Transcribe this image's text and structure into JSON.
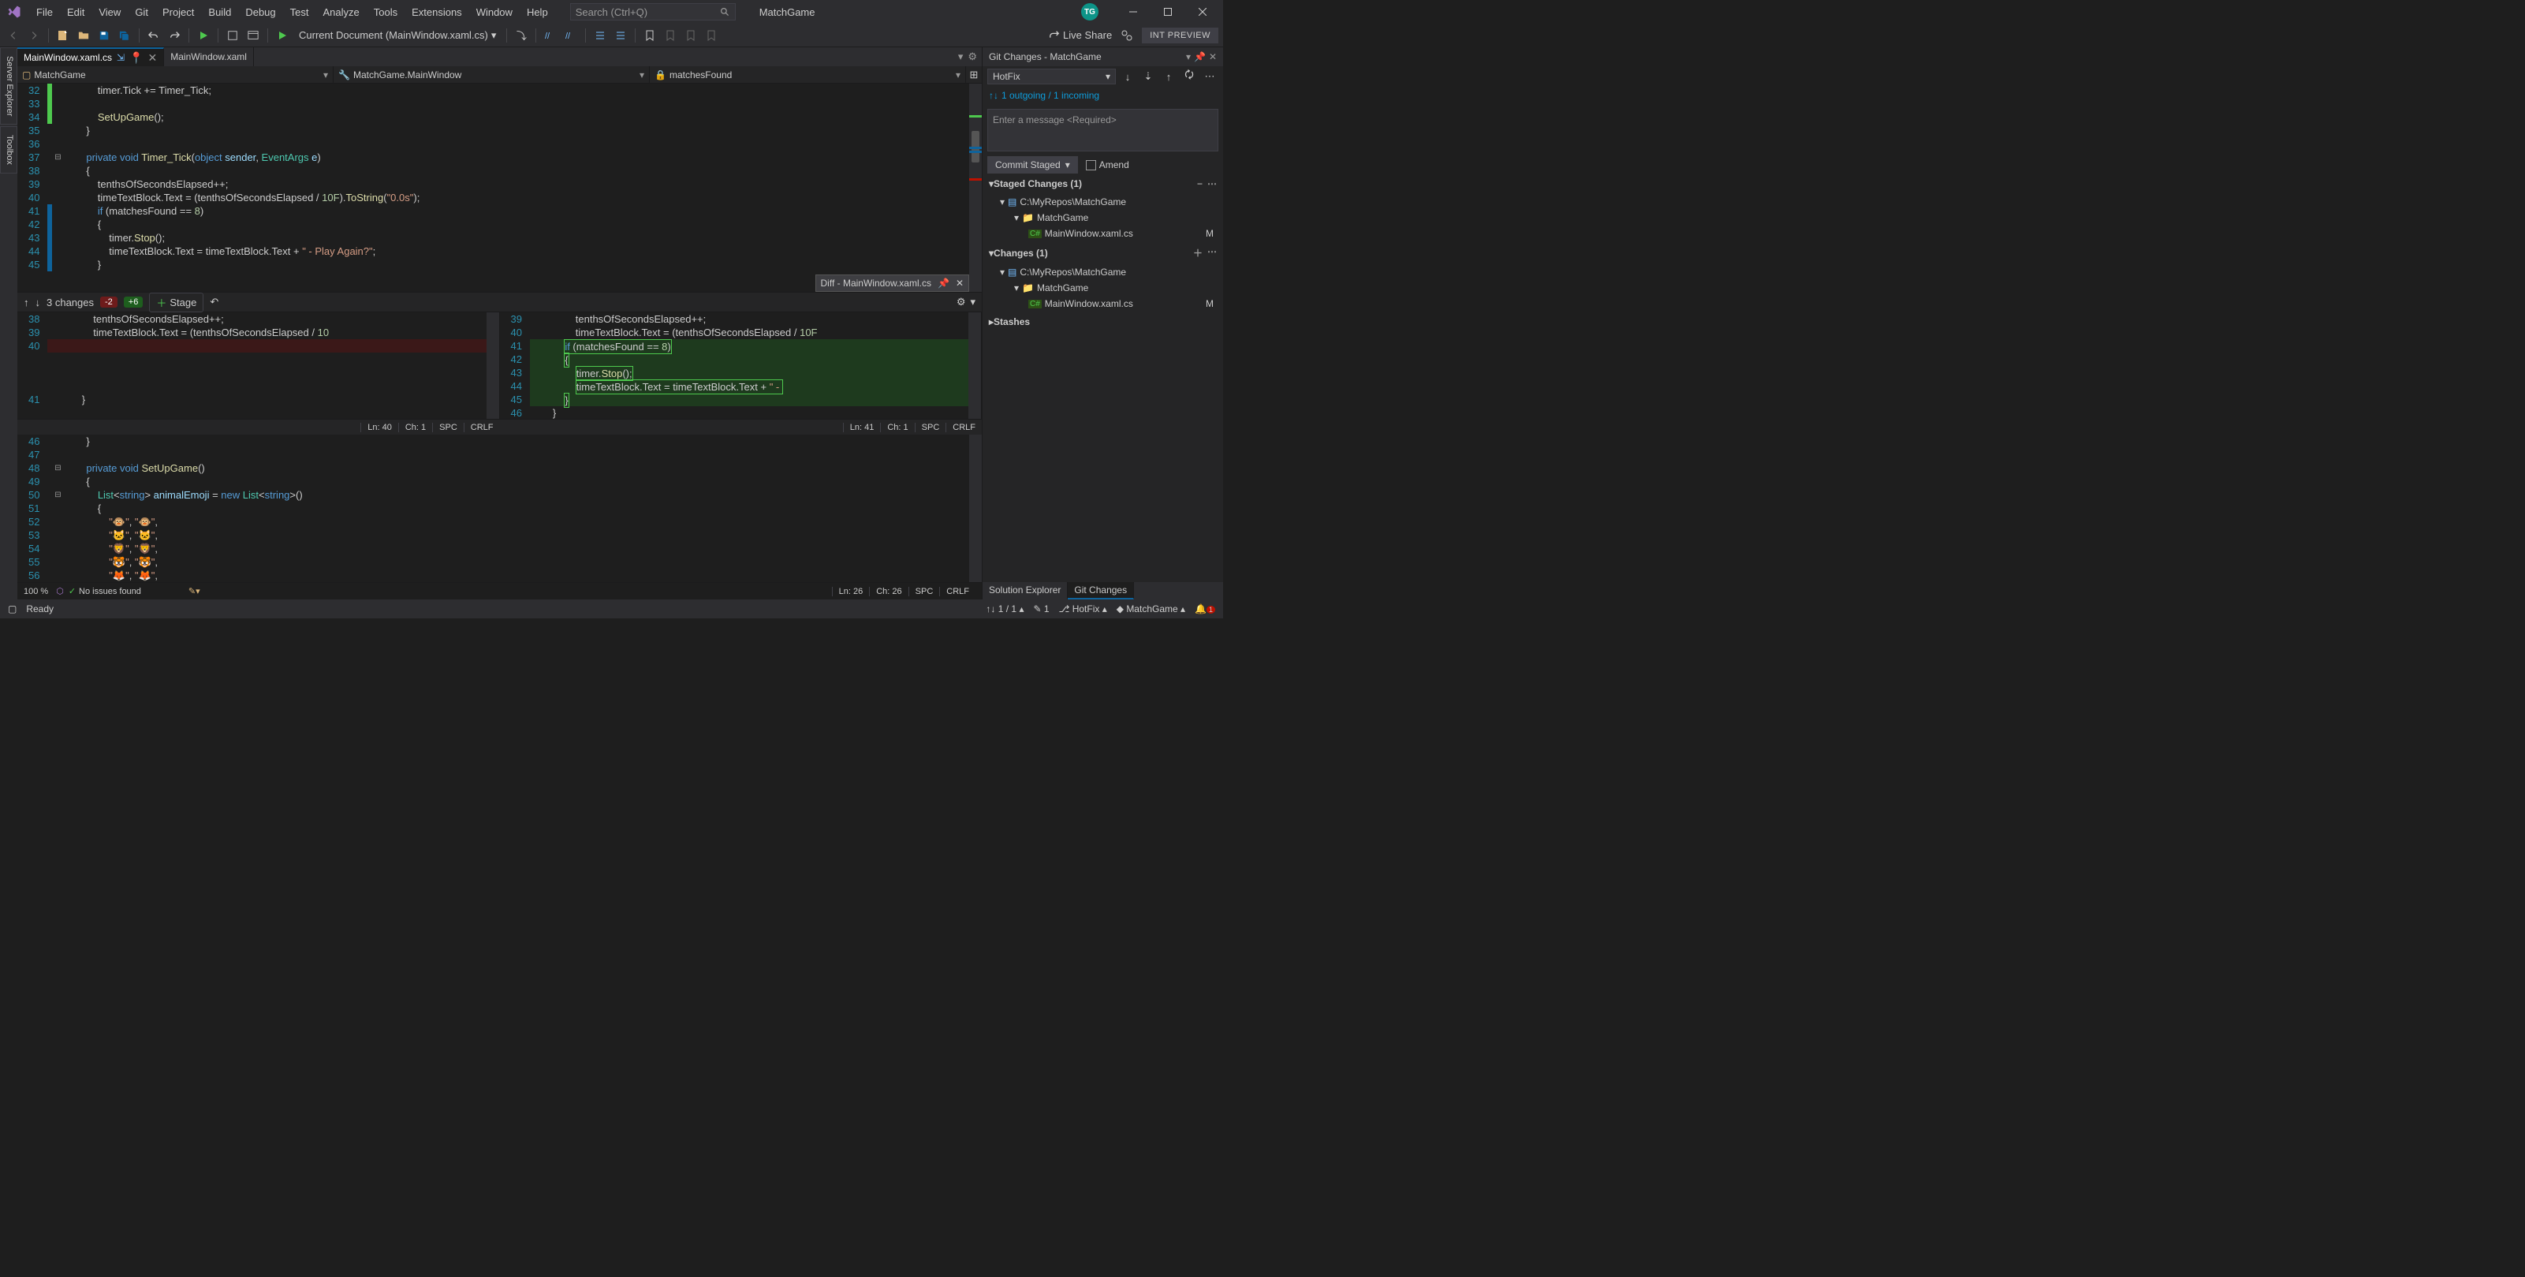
{
  "titlebar": {
    "menus": [
      "File",
      "Edit",
      "View",
      "Git",
      "Project",
      "Build",
      "Debug",
      "Test",
      "Analyze",
      "Tools",
      "Extensions",
      "Window",
      "Help"
    ],
    "search_placeholder": "Search (Ctrl+Q)",
    "solution": "MatchGame",
    "avatar": "TG"
  },
  "toolbar": {
    "current_doc": "Current Document (MainWindow.xaml.cs)",
    "live_share": "Live Share",
    "int_preview": "INT PREVIEW"
  },
  "side_tabs": [
    "Server Explorer",
    "Toolbox"
  ],
  "doc_tabs": [
    {
      "label": "MainWindow.xaml.cs",
      "active": true
    },
    {
      "label": "MainWindow.xaml",
      "active": false
    }
  ],
  "nav": {
    "ns": "MatchGame",
    "cls": "MatchGame.MainWindow",
    "mem": "matchesFound"
  },
  "code_top": [
    {
      "n": 32,
      "html": "            timer.Tick += Timer_Tick;"
    },
    {
      "n": 33,
      "html": ""
    },
    {
      "n": 34,
      "html": "            <span class='fn'>SetUpGame</span>();"
    },
    {
      "n": 35,
      "html": "        }"
    },
    {
      "n": 36,
      "html": ""
    },
    {
      "n": 37,
      "html": "        <span class='kw'>private</span> <span class='kw'>void</span> <span class='fn'>Timer_Tick</span>(<span class='kw'>object</span> <span class='param'>sender</span>, <span class='type'>EventArgs</span> <span class='param'>e</span>)"
    },
    {
      "n": 38,
      "html": "        {"
    },
    {
      "n": 39,
      "html": "            tenthsOfSecondsElapsed++;"
    },
    {
      "n": 40,
      "html": "            timeTextBlock.Text = (tenthsOfSecondsElapsed / <span class='num'>10F</span>).<span class='fn'>ToString</span>(<span class='str'>\"0.0s\"</span>);"
    },
    {
      "n": 41,
      "html": "            <span class='kw'>if</span> (matchesFound == <span class='num'>8</span>)"
    },
    {
      "n": 42,
      "html": "            {"
    },
    {
      "n": 43,
      "html": "                timer.<span class='fn'>Stop</span>();"
    },
    {
      "n": 44,
      "html": "                timeTextBlock.Text = timeTextBlock.Text + <span class='str'>\" - Play Again?\"</span>;"
    },
    {
      "n": 45,
      "html": "            }"
    }
  ],
  "diff": {
    "tab_label": "Diff - MainWindow.xaml.cs",
    "changes": "3 changes",
    "removed": "-2",
    "added": "+6",
    "stage": "Stage",
    "left": [
      {
        "n": 38,
        "html": "                tenthsOfSecondsElapsed++;"
      },
      {
        "n": 39,
        "html": "                timeTextBlock.Text = (tenthsOfSecondsElapsed / <span class='num'>10</span>"
      },
      {
        "n": 40,
        "html": "",
        "del": true
      },
      {
        "n": "",
        "html": ""
      },
      {
        "n": "",
        "html": ""
      },
      {
        "n": "",
        "html": ""
      },
      {
        "n": 41,
        "html": "            }"
      }
    ],
    "right": [
      {
        "n": 39,
        "html": "                tenthsOfSecondsElapsed++;"
      },
      {
        "n": 40,
        "html": "                timeTextBlock.Text = (tenthsOfSecondsElapsed / <span class='num'>10F</span>"
      },
      {
        "n": 41,
        "html": "            <span class='add-box'><span class='kw'>if</span> (matchesFound == <span class='num'>8</span>)</span>",
        "add": true
      },
      {
        "n": 42,
        "html": "            <span class='add-box'>{</span>",
        "add": true
      },
      {
        "n": 43,
        "html": "                <span class='add-box'>timer.<span class='fn'>Stop</span>();</span>",
        "add": true
      },
      {
        "n": 44,
        "html": "                <span class='add-box'>timeTextBlock.Text = timeTextBlock.Text + <span class='str'>\" - </span></span>",
        "add": true
      },
      {
        "n": 45,
        "html": "            <span class='add-box'>}</span>",
        "add": true
      },
      {
        "n": 46,
        "html": "        }"
      }
    ],
    "status_left": {
      "ln": "Ln: 40",
      "ch": "Ch: 1",
      "spc": "SPC",
      "crlf": "CRLF"
    },
    "status_right": {
      "ln": "Ln: 41",
      "ch": "Ch: 1",
      "spc": "SPC",
      "crlf": "CRLF"
    }
  },
  "code_bottom": [
    {
      "n": 46,
      "html": "        }"
    },
    {
      "n": 47,
      "html": ""
    },
    {
      "n": 48,
      "html": "        <span class='kw'>private</span> <span class='kw'>void</span> <span class='fn'>SetUpGame</span>()"
    },
    {
      "n": 49,
      "html": "        {"
    },
    {
      "n": 50,
      "html": "            <span class='type'>List</span>&lt;<span class='kw'>string</span>&gt; <span class='param'>animalEmoji</span> = <span class='kw'>new</span> <span class='type'>List</span>&lt;<span class='kw'>string</span>&gt;()"
    },
    {
      "n": 51,
      "html": "            {"
    },
    {
      "n": 52,
      "html": "                <span class='str'>\"🐵\"</span>, <span class='str'>\"🐵\"</span>,"
    },
    {
      "n": 53,
      "html": "                <span class='str'>\"🐱\"</span>, <span class='str'>\"🐱\"</span>,"
    },
    {
      "n": 54,
      "html": "                <span class='str'>\"🦁\"</span>, <span class='str'>\"🦁\"</span>,"
    },
    {
      "n": 55,
      "html": "                <span class='str'>\"🐯\"</span>, <span class='str'>\"🐯\"</span>,"
    },
    {
      "n": 56,
      "html": "                <span class='str'>\"🦊\"</span>, <span class='str'>\"🦊\"</span>,"
    }
  ],
  "editor_status": {
    "zoom": "100 %",
    "issues": "No issues found",
    "ln": "Ln: 26",
    "ch": "Ch: 26",
    "spc": "SPC",
    "crlf": "CRLF"
  },
  "git": {
    "title": "Git Changes - MatchGame",
    "branch": "HotFix",
    "outgoing": "1 outgoing / 1 incoming",
    "msg_placeholder": "Enter a message <Required>",
    "commit_btn": "Commit Staged",
    "amend": "Amend",
    "staged_head": "Staged Changes (1)",
    "changes_head": "Changes (1)",
    "stashes": "Stashes",
    "repo": "C:\\MyRepos\\MatchGame",
    "proj": "MatchGame",
    "file": "MainWindow.xaml.cs",
    "file_status": "M"
  },
  "panel_tabs": [
    "Solution Explorer",
    "Git Changes"
  ],
  "statusbar": {
    "ready": "Ready",
    "sync": "1 / 1",
    "pencil": "1",
    "branch": "HotFix",
    "repo": "MatchGame",
    "bell": "1"
  }
}
